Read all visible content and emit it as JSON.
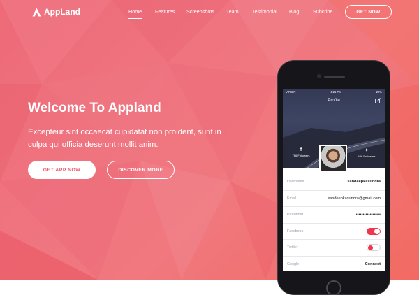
{
  "brand": {
    "name": "AppLand"
  },
  "nav": {
    "items": [
      {
        "label": "Home",
        "active": true
      },
      {
        "label": "Features"
      },
      {
        "label": "Screenshots"
      },
      {
        "label": "Team"
      },
      {
        "label": "Testimonial"
      },
      {
        "label": "Blog"
      },
      {
        "label": "Subcribe"
      }
    ],
    "cta_label": "GET NOW"
  },
  "hero": {
    "title": "Welcome To Appland",
    "text": "Excepteur sint occaecat cupidatat non proident, sunt in culpa qui officia deserunt mollit anim.",
    "primary_button": "GET APP NOW",
    "secondary_button": "DISCOVER MORE"
  },
  "phone": {
    "status": {
      "carrier": "VIRGIN",
      "time": "4:21 PM",
      "battery": "22%"
    },
    "profile_title": "Profile",
    "facebook_followers": "786 Followers",
    "twitter_followers": "456 Followers",
    "rows": [
      {
        "label": "Username",
        "value": "sandeepkasundra"
      },
      {
        "label": "Email",
        "value": "sandeepkasundra@gmail.com"
      },
      {
        "label": "Password",
        "value": "••••••••••••••••••"
      },
      {
        "label": "Facebook",
        "toggle": "on"
      },
      {
        "label": "Twitter",
        "toggle": "off"
      },
      {
        "label": "Google+",
        "value": "Connect"
      }
    ]
  },
  "colors": {
    "hero_start": "#ee6a78",
    "hero_end": "#f26a62",
    "accent": "#f0364e",
    "primary_text": "#ee5a6a"
  },
  "icons": [
    "appland-logo-icon",
    "hamburger-icon",
    "edit-icon",
    "facebook-icon",
    "twitter-icon",
    "wifi-icon",
    "battery-icon",
    "bluetooth-icon"
  ]
}
